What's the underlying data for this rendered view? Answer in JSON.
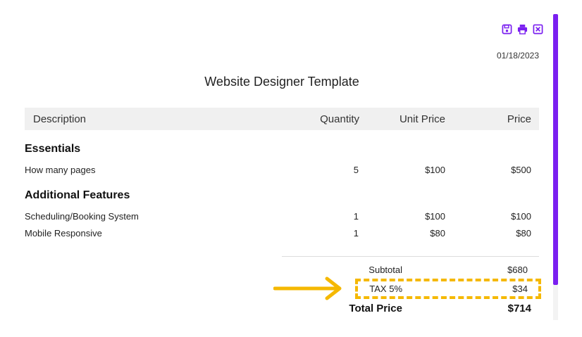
{
  "toolbar": {
    "icons": [
      "save-icon",
      "print-icon",
      "close-icon"
    ]
  },
  "document": {
    "date": "01/18/2023",
    "title": "Website Designer Template"
  },
  "table": {
    "headers": {
      "description": "Description",
      "quantity": "Quantity",
      "unit_price": "Unit Price",
      "price": "Price"
    },
    "sections": [
      {
        "title": "Essentials",
        "rows": [
          {
            "description": "How many pages",
            "quantity": "5",
            "unit_price": "$100",
            "price": "$500"
          }
        ]
      },
      {
        "title": "Additional Features",
        "rows": [
          {
            "description": "Scheduling/Booking System",
            "quantity": "1",
            "unit_price": "$100",
            "price": "$100"
          },
          {
            "description": "Mobile Responsive",
            "quantity": "1",
            "unit_price": "$80",
            "price": "$80"
          }
        ]
      }
    ]
  },
  "summary": {
    "subtotal_label": "Subtotal",
    "subtotal_value": "$680",
    "tax_label": "TAX 5%",
    "tax_value": "$34",
    "total_label": "Total Price",
    "total_value": "$714"
  },
  "colors": {
    "accent": "#7a1ff0",
    "highlight": "#f5b800"
  }
}
